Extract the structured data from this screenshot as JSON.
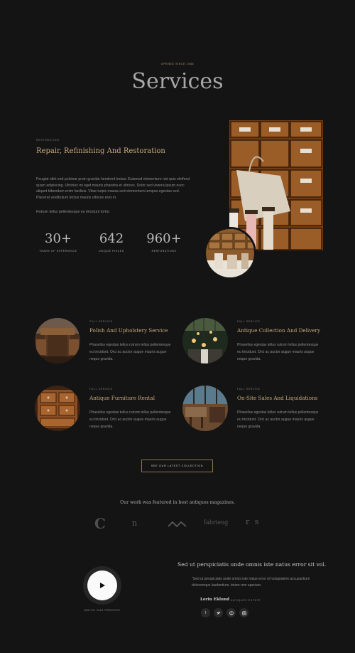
{
  "hero": {
    "eyebrow": "Opened since 1986",
    "title": "Services"
  },
  "restoration": {
    "eyebrow": "Restoration",
    "title": "Repair, Refinishing And Restoration",
    "paragraph1": "Feugiat nibh sed pulvinar proin gravida hendrerit lectus. Euismod elementum nisi quis eleifend quam adipiscing. Ultricies mi eget mauris pharetra et ultrices. Dolor sed viverra ipsum nunc aliquet bibendum enim facilisis. Vitae turpis massa sed elementum tempus egestas sed. Placerat vestibulum lectus mauris ultrices eros in.",
    "paragraph2": "Rutrum tellus pellentesque eu tincidunt tortor.",
    "stats": [
      {
        "value": "30+",
        "label": "Years of experience"
      },
      {
        "value": "642",
        "label": "Unique pieces"
      },
      {
        "value": "960+",
        "label": "Restorations"
      }
    ]
  },
  "services": [
    {
      "tag": "Full service",
      "title": "Polish And Upholstery Service",
      "description": "Phasellus egestas tellus rutrum tellus pellentesque eu tincidunt. Orci ac auctor augue mauris augue neque gravida."
    },
    {
      "tag": "Full service",
      "title": "Antique Collection And Delivery",
      "description": "Phasellus egestas tellus rutrum tellus pellentesque eu tincidunt. Orci ac auctor augue mauris augue neque gravida."
    },
    {
      "tag": "Full service",
      "title": "Antique Furniture Rental",
      "description": "Phasellus egestas tellus rutrum tellus pellentesque eu tincidunt. Orci ac auctor augue mauris augue neque gravida."
    },
    {
      "tag": "Full service",
      "title": "On-Site Sales And Liquidations",
      "description": "Phasellus egestas tellus rutrum tellus pellentesque eu tincidunt. Orci ac auctor augue mauris augue neque gravida."
    }
  ],
  "cta": {
    "label": "See our latest collection"
  },
  "featured": {
    "heading": "Our work was featured in best antiques magazines.",
    "logos": [
      "C",
      "n",
      "fabrieng",
      "r s"
    ]
  },
  "video": {
    "label": "Watch our process"
  },
  "testimonial": {
    "heading": "Sed ut perspiciatis unde omnis iste natus error sit vol.",
    "quote": "\"Sed ut perspiciatis unde omnis iste natus error sit voluptatem accusantium doloremque laudantium, totam rem aperiam.",
    "author": "Lorin Eklund",
    "role": "Antiques expert"
  },
  "social": [
    "facebook-icon",
    "twitter-icon",
    "pinterest-icon",
    "instagram-icon"
  ],
  "colors": {
    "background": "#141414",
    "accent": "#c8a87c",
    "muted": "#8e8e8e"
  }
}
